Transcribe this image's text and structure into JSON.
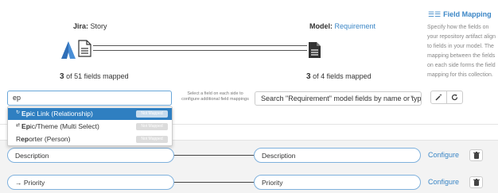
{
  "header": {
    "source": {
      "label": "Jira:",
      "name": "Story",
      "count": "3",
      "count_text": "of 51 fields mapped"
    },
    "target": {
      "label": "Model:",
      "name": "Requirement",
      "count": "3",
      "count_text": "of 4 fields mapped"
    }
  },
  "panel": {
    "icon": "☰☰",
    "title": "Field Mapping",
    "description": "Specify how the fields on your repository artifact align to fields in your model. The mapping between the fields on each side forms the field mapping for this collection."
  },
  "search": {
    "value": "ep",
    "hint": "Select a field on each side to configure additional field mappings",
    "target_placeholder": "Search \"Requirement\" model fields by name or type"
  },
  "dropdown": {
    "items": [
      {
        "prefix": "↻",
        "match": "Ep",
        "rest": "ic Link (Relationship)",
        "badge": "Not Mapped"
      },
      {
        "prefix": "⇄",
        "match": "Ep",
        "rest": "ic/Theme (Multi Select)",
        "badge": "Not Mapped"
      },
      {
        "prefix": "",
        "pre_text": "R",
        "match": "ep",
        "rest": "orter (Person)",
        "badge": "Not Mapped"
      }
    ]
  },
  "mappings": [
    {
      "left": "Description",
      "right": "Description",
      "configure": "Configure"
    },
    {
      "left": "→ Priority",
      "right": "Priority",
      "configure": "Configure"
    }
  ],
  "colors": {
    "accent": "#3b86c6",
    "highlight": "#2f7fc1",
    "pill_border": "#7fb1dd"
  },
  "icons": [
    "jira-logo-icon",
    "document-icon",
    "menu-icon",
    "magic-wand-icon",
    "refresh-icon",
    "trash-icon"
  ]
}
